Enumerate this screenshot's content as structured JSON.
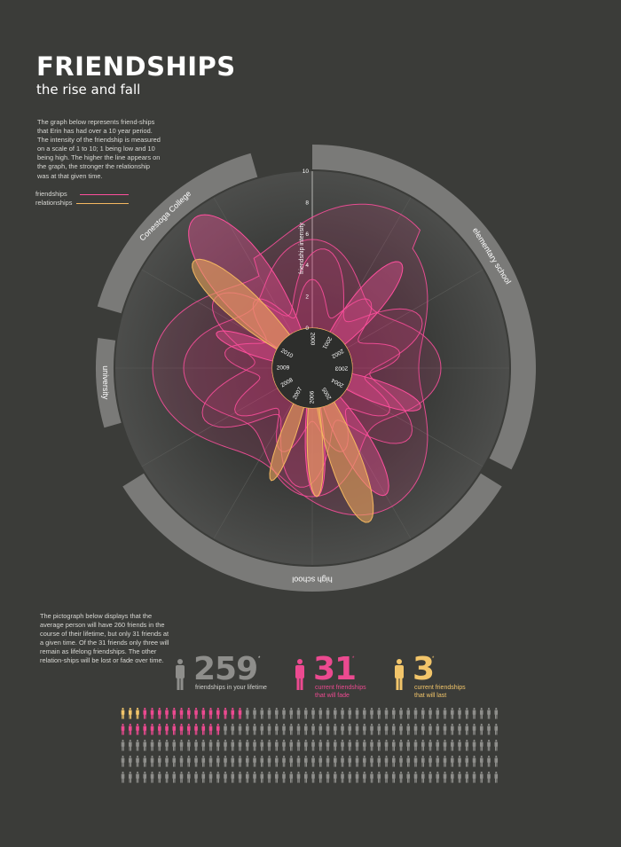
{
  "header": {
    "title": "FRIENDSHIPS",
    "subtitle": "the rise and fall"
  },
  "intro_text": "The graph below represents friend-ships that Erin has had over a 10 year period. The intensity of the friendship is measured on a scale of 1 to 10; 1 being low and 10 being high. The higher the line appears on the graph, the stronger the relationship was at that given time.",
  "legend": {
    "items": [
      {
        "label": "friendships",
        "color": "#ff4f9d"
      },
      {
        "label": "relationships",
        "color": "#f5b860"
      }
    ]
  },
  "radial": {
    "axis_label": "friendship intensity",
    "scale_ticks": [
      "0",
      "2",
      "4",
      "6",
      "8",
      "10"
    ],
    "years": [
      "2000",
      "2001",
      "2002",
      "2003",
      "2004",
      "2005",
      "2006",
      "2007",
      "2008",
      "2009",
      "2010"
    ],
    "periods": [
      {
        "label": "elementary school"
      },
      {
        "label": "high school"
      },
      {
        "label": "university"
      },
      {
        "label": "Conestoga College"
      }
    ]
  },
  "pictograph": {
    "intro_text": "The pictograph below displays that the average person will have 260 friends in the course of their lifetime, but only 31 friends at a given time. Of the 31 friends only three will remain as lifelong friendships. The other relation-ships will be lost or fade over time.",
    "stats": [
      {
        "number": "259",
        "sup": "*",
        "caption": [
          "friendships in your lifetime"
        ],
        "color": "#8e8e8b"
      },
      {
        "number": "31",
        "sup": "*",
        "caption": [
          "current friendships",
          "that will fade"
        ],
        "color": "#ec4a90"
      },
      {
        "number": "3",
        "sup": "*",
        "caption": [
          "current friendships",
          "that will last"
        ],
        "color": "#f2c56a"
      }
    ],
    "grid": {
      "total": 260,
      "lasting": 3,
      "fading": 28
    },
    "colors": {
      "lasting": "#f2c56a",
      "fading": "#ec4a90",
      "other": "#8e8e8b"
    }
  }
}
